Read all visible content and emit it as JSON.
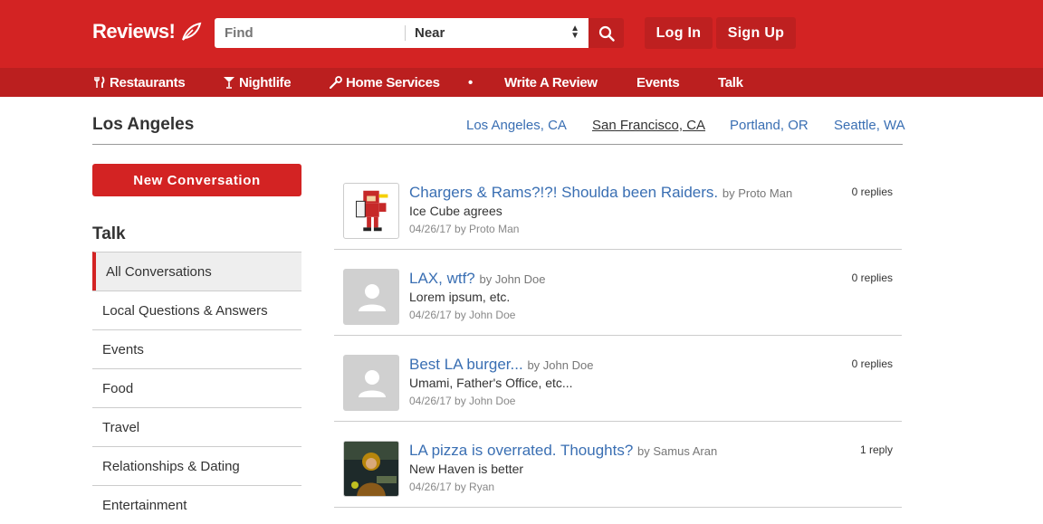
{
  "header": {
    "logo_text": "Reviews!",
    "search": {
      "find_placeholder": "Find",
      "near_label": "Near"
    },
    "login_label": "Log In",
    "signup_label": "Sign Up",
    "brand_color": "#d32323"
  },
  "nav": {
    "restaurants": "Restaurants",
    "nightlife": "Nightlife",
    "home_services": "Home Services",
    "separator": "•",
    "write_review": "Write A Review",
    "events": "Events",
    "talk": "Talk"
  },
  "city": {
    "title": "Los Angeles",
    "links": [
      "Los Angeles, CA",
      "San Francisco, CA",
      "Portland, OR",
      "Seattle, WA"
    ]
  },
  "sidebar": {
    "new_conversation": "New Conversation",
    "talk_title": "Talk",
    "items": [
      "All Conversations",
      "Local Questions & Answers",
      "Events",
      "Food",
      "Travel",
      "Relationships & Dating",
      "Entertainment"
    ]
  },
  "conversations": [
    {
      "title": "Chargers & Rams?!?! Shoulda been Raiders.",
      "by": "by Proto Man",
      "snippet": "Ice Cube agrees",
      "meta": "04/26/17 by Proto Man",
      "replies": "0 replies",
      "avatar": "robot-avatar"
    },
    {
      "title": "LAX, wtf?",
      "by": "by John Doe",
      "snippet": "Lorem ipsum, etc.",
      "meta": "04/26/17 by John Doe",
      "replies": "0 replies",
      "avatar": "default-user-icon"
    },
    {
      "title": "Best LA burger...",
      "by": "by John Doe",
      "snippet": "Umami, Father's Office, etc...",
      "meta": "04/26/17 by John Doe",
      "replies": "0 replies",
      "avatar": "default-user-icon"
    },
    {
      "title": "LA pizza is overrated. Thoughts?",
      "by": "by Samus Aran",
      "snippet": "New Haven is better",
      "meta": "04/26/17 by Ryan",
      "replies": "1 reply",
      "avatar": "armored-hero-avatar"
    }
  ]
}
